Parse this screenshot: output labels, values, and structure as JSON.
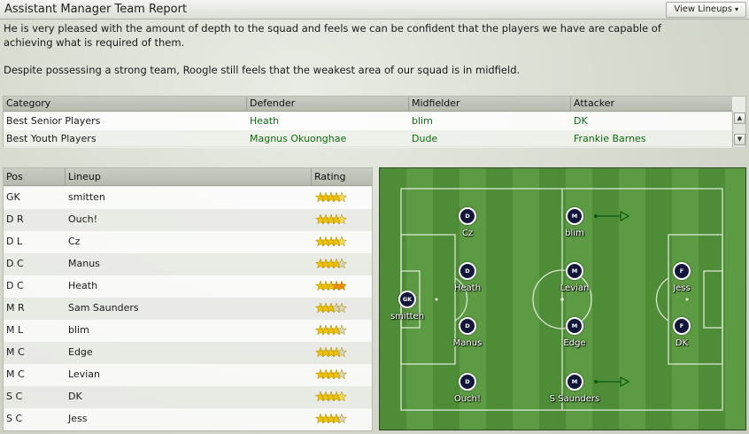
{
  "window": {
    "title": "Assistant Manager Team Report",
    "view_lineups_label": "View Lineups"
  },
  "report": {
    "paragraph1": "He is very pleased with the amount of depth to the squad and feels we can be confident that the players we have are capable of achieving what is required of them.",
    "paragraph2": "Despite possessing a strong team, Roogle still feels that the weakest area of our squad is in midfield."
  },
  "categories": {
    "headers": [
      "Category",
      "Defender",
      "Midfielder",
      "Attacker"
    ],
    "rows": [
      {
        "category": "Best Senior Players",
        "defender": "Heath",
        "midfielder": "blim",
        "attacker": "DK"
      },
      {
        "category": "Best Youth Players",
        "defender": "Magnus Okuonghae",
        "midfielder": "Dude",
        "attacker": "Frankie Barnes"
      }
    ]
  },
  "lineup": {
    "headers": [
      "Pos",
      "Lineup",
      "Rating"
    ],
    "rows": [
      {
        "pos": "GK",
        "name": "smitten",
        "stars": 4.5
      },
      {
        "pos": "D R",
        "name": "Ouch!",
        "stars": 4.5
      },
      {
        "pos": "D L",
        "name": "Cz",
        "stars": 4.5
      },
      {
        "pos": "D C",
        "name": "Manus",
        "stars": 4
      },
      {
        "pos": "D C",
        "name": "Heath",
        "stars": 5
      },
      {
        "pos": "M R",
        "name": "Sam Saunders",
        "stars": 3
      },
      {
        "pos": "M L",
        "name": "blim",
        "stars": 4
      },
      {
        "pos": "M C",
        "name": "Edge",
        "stars": 4
      },
      {
        "pos": "M C",
        "name": "Levian",
        "stars": 4
      },
      {
        "pos": "S C",
        "name": "DK",
        "stars": 4.5
      },
      {
        "pos": "S C",
        "name": "Jess",
        "stars": 4
      }
    ]
  },
  "pitch": {
    "players": [
      {
        "badge": "GK",
        "name": "smitten"
      },
      {
        "badge": "D",
        "name": "Cz"
      },
      {
        "badge": "D",
        "name": "Heath"
      },
      {
        "badge": "D",
        "name": "Manus"
      },
      {
        "badge": "D",
        "name": "Ouch!"
      },
      {
        "badge": "M",
        "name": "blim"
      },
      {
        "badge": "M",
        "name": "Levian"
      },
      {
        "badge": "M",
        "name": "Edge"
      },
      {
        "badge": "M",
        "name": "S Saunders"
      },
      {
        "badge": "F",
        "name": "Jess"
      },
      {
        "badge": "F",
        "name": "DK"
      }
    ]
  },
  "colors": {
    "star_gold": "#f2c200",
    "star_orange": "#f08a00",
    "pitch_green": "#55913d",
    "player_navy": "#12173a",
    "name_green": "#0f6b0f"
  }
}
